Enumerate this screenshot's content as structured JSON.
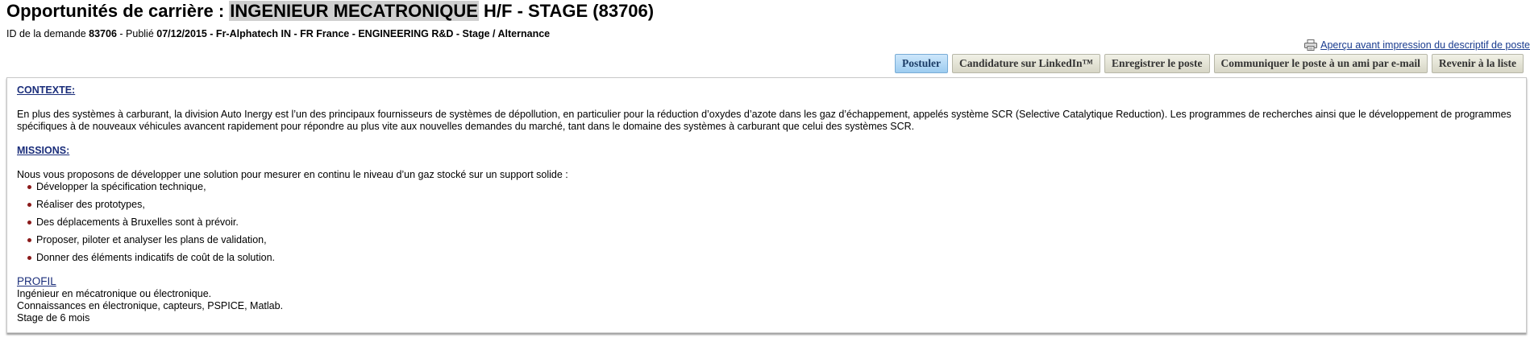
{
  "header": {
    "title_prefix": "Opportunités de carrière : ",
    "title_highlight": "INGENIEUR MECATRONIQUE",
    "title_suffix": " H/F - STAGE (83706)"
  },
  "meta": {
    "id_label": "ID de la demande ",
    "id_value": "83706",
    "published_label": " - Publié ",
    "published_date": "07/12/2015",
    "details": " - Fr-Alphatech IN - FR France - ENGINEERING R&D - Stage / Alternance"
  },
  "print_link": {
    "label": "Aperçu avant impression du descriptif de poste",
    "icon": "printer-icon"
  },
  "toolbar": {
    "apply": "Postuler",
    "linkedin": "Candidature sur LinkedIn™",
    "save": "Enregistrer le poste",
    "share": "Communiquer le poste à un ami par e-mail",
    "back": "Revenir à la liste"
  },
  "content": {
    "context_heading": "CONTEXTE:",
    "context_text": "En plus des systèmes à carburant, la division Auto Inergy est l’un des principaux fournisseurs de systèmes de dépollution, en particulier pour la réduction d’oxydes d’azote dans les gaz d’échappement, appelés système SCR (Selective Catalytique Reduction). Les programmes de recherches ainsi que le développement de programmes spécifiques à de nouveaux véhicules avancent rapidement pour répondre au plus vite aux nouvelles demandes du marché, tant dans le domaine des systèmes à carburant que celui des systèmes SCR.",
    "missions_heading": "MISSIONS:",
    "missions_intro": "Nous vous proposons de développer une solution pour mesurer en continu le niveau d’un gaz stocké sur un support solide :",
    "missions": [
      "Développer la spécification technique,",
      "Réaliser des prototypes,",
      "Des déplacements à Bruxelles sont à prévoir.",
      "Proposer, piloter et analyser les plans de validation,",
      "Donner des éléments indicatifs de coût de la solution."
    ],
    "profile_heading": "PROFIL",
    "profile_lines": [
      "Ingénieur en mécatronique ou électronique.",
      "Connaissances en électronique, capteurs, PSPICE, Matlab.",
      "Stage de 6 mois"
    ]
  }
}
